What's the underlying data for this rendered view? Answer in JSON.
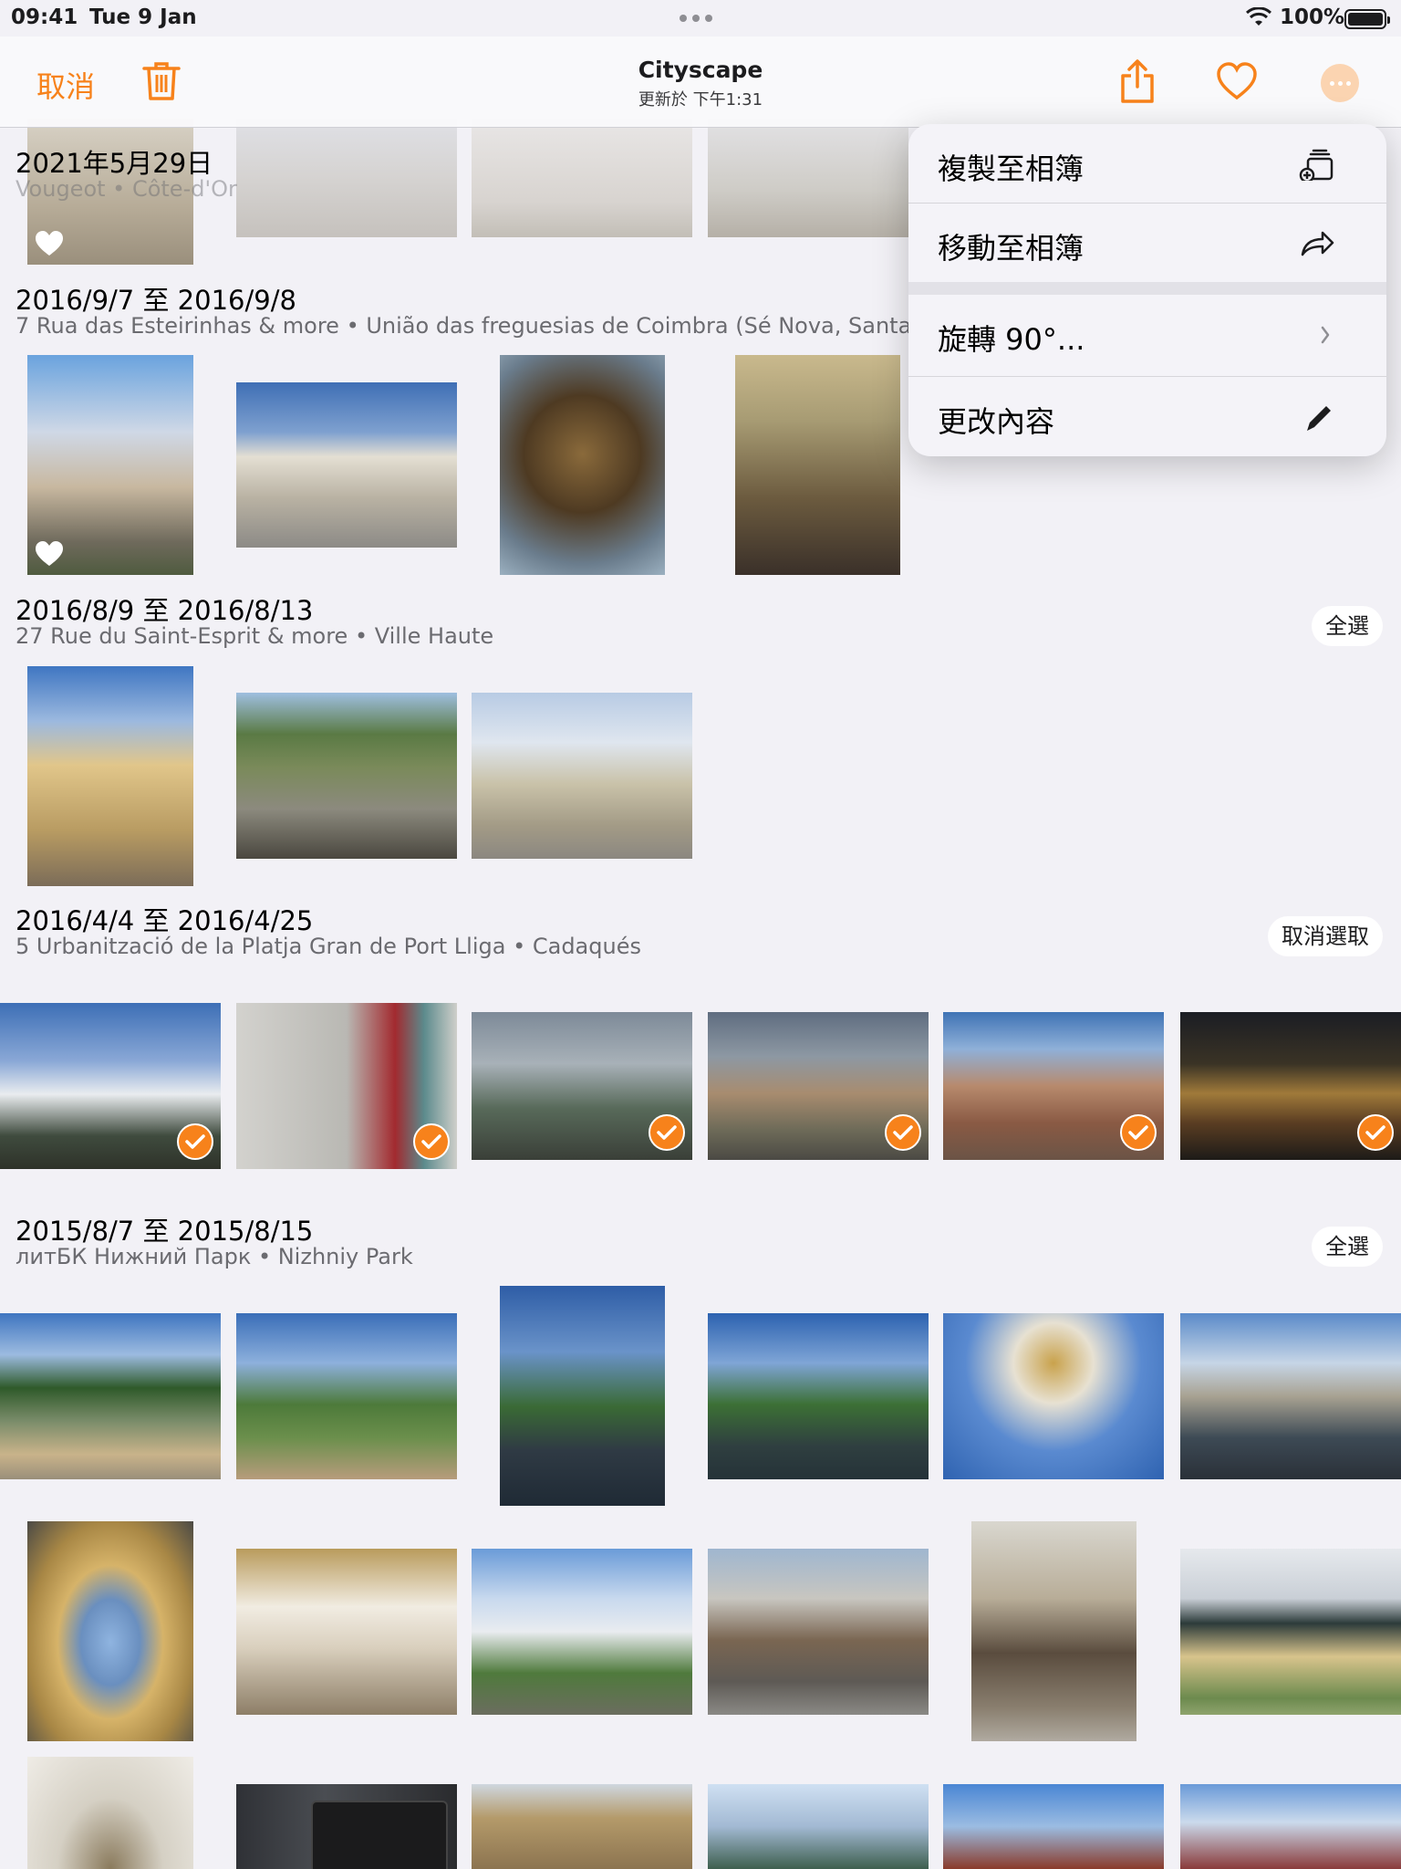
{
  "status_bar": {
    "time": "09:41",
    "date": "Tue 9 Jan",
    "battery": "100%"
  },
  "nav": {
    "cancel": "取消",
    "title": "Cityscape",
    "subtitle": "更新於 下午1:31"
  },
  "menu": {
    "copy": "複製至相簿",
    "move": "移動至相簿",
    "rotate": "旋轉 90°...",
    "edit": "更改內容"
  },
  "sections": [
    {
      "title": "2021年5月29日",
      "subtitle": "Vougeot • Côte-d'Or"
    },
    {
      "title": "2016/9/7 至 2016/9/8",
      "subtitle": "7 Rua das Esteirinhas & more • União das freguesias de Coimbra (Sé Nova, Santa"
    },
    {
      "title": "2016/8/9 至 2016/8/13",
      "subtitle": "27 Rue du Saint-Esprit & more • Ville Haute",
      "action": "全選"
    },
    {
      "title": "2016/4/4 至 2016/4/25",
      "subtitle": "5 Urbanització de la Platja Gran de Port Lliga • Cadaqués",
      "action": "取消選取"
    },
    {
      "title": "2015/8/7 至 2015/8/15",
      "subtitle": "литБК Нижний Парк • Nizhniy Park",
      "action": "全選"
    }
  ],
  "colors": {
    "accent": "#f7821b",
    "background": "#f2f1f6",
    "menu": "#f4f3f8"
  },
  "icons": [
    "trash-icon",
    "share-icon",
    "heart-icon",
    "more-icon",
    "copy-to-album-icon",
    "move-icon",
    "chevron-right-icon",
    "pencil-icon",
    "checkmark-icon",
    "favorite-heart-icon"
  ]
}
